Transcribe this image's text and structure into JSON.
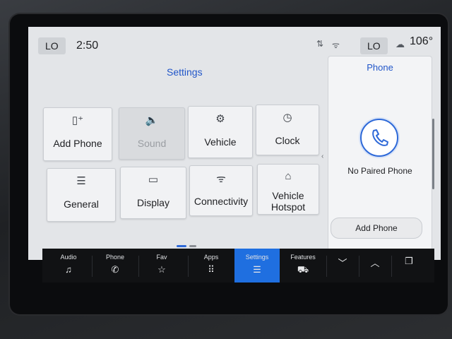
{
  "status_bar": {
    "left_climate": "LO",
    "time": "2:50",
    "right_climate": "LO",
    "outside_temp": "106°",
    "icons": [
      "data-signal-icon",
      "wifi-icon",
      "outside-temp-icon"
    ]
  },
  "page_title": "Settings",
  "tiles": [
    {
      "label": "Add Phone",
      "icon": "add-phone-icon",
      "glyph": "▯⁺",
      "enabled": true
    },
    {
      "label": "Sound",
      "icon": "speaker-icon",
      "glyph": "🔈",
      "enabled": false
    },
    {
      "label": "Vehicle",
      "icon": "vehicle-settings-icon",
      "glyph": "⚙",
      "enabled": true
    },
    {
      "label": "Clock",
      "icon": "clock-icon",
      "glyph": "◷",
      "enabled": true
    },
    {
      "label": "General",
      "icon": "sliders-icon",
      "glyph": "☰",
      "enabled": true
    },
    {
      "label": "Display",
      "icon": "display-icon",
      "glyph": "▭",
      "enabled": true
    },
    {
      "label": "Connectivity",
      "icon": "wifi-icon",
      "glyph": "ᯤ",
      "enabled": true
    },
    {
      "label": "Vehicle Hotspot",
      "label_line1": "Vehicle",
      "label_line2": "Hotspot",
      "icon": "hotspot-car-icon",
      "glyph": "⌂",
      "enabled": true
    }
  ],
  "phone_panel": {
    "title": "Phone",
    "status": "No Paired Phone",
    "add_button": "Add Phone",
    "icon": "phone-icon"
  },
  "nav": [
    {
      "label": "Audio",
      "icon": "music-note-icon",
      "glyph": "♫"
    },
    {
      "label": "Phone",
      "icon": "phone-icon",
      "glyph": "✆"
    },
    {
      "label": "Fav",
      "icon": "star-icon",
      "glyph": "☆"
    },
    {
      "label": "Apps",
      "icon": "apps-grid-icon",
      "glyph": "⠿"
    },
    {
      "label": "Settings",
      "icon": "sliders-icon",
      "glyph": "☰",
      "active": true
    },
    {
      "label": "Features",
      "icon": "truck-icon",
      "glyph": "⛟"
    },
    {
      "label": "",
      "icon": "chevron-down-icon",
      "glyph": "﹀"
    },
    {
      "label": "",
      "icon": "chevron-up-icon",
      "glyph": "︿"
    },
    {
      "label": "",
      "icon": "copy-screens-icon",
      "glyph": "❐"
    }
  ],
  "colors": {
    "accent": "#2156c9",
    "active_nav": "#1f6fe0"
  }
}
